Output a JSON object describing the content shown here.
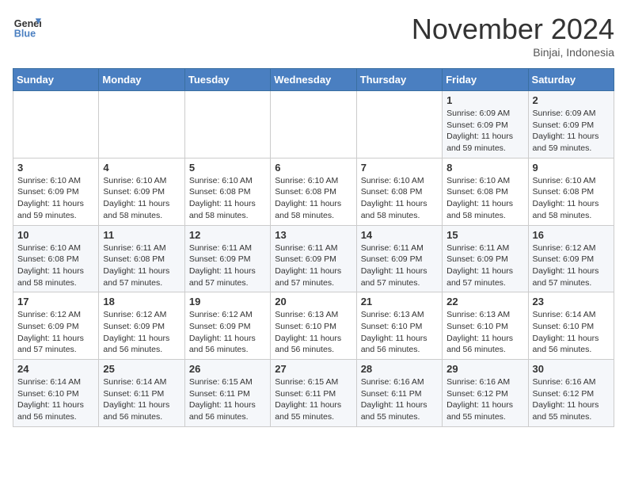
{
  "header": {
    "logo_line1": "General",
    "logo_line2": "Blue",
    "month_title": "November 2024",
    "location": "Binjai, Indonesia"
  },
  "weekdays": [
    "Sunday",
    "Monday",
    "Tuesday",
    "Wednesday",
    "Thursday",
    "Friday",
    "Saturday"
  ],
  "weeks": [
    [
      {
        "day": "",
        "info": ""
      },
      {
        "day": "",
        "info": ""
      },
      {
        "day": "",
        "info": ""
      },
      {
        "day": "",
        "info": ""
      },
      {
        "day": "",
        "info": ""
      },
      {
        "day": "1",
        "info": "Sunrise: 6:09 AM\nSunset: 6:09 PM\nDaylight: 11 hours and 59 minutes."
      },
      {
        "day": "2",
        "info": "Sunrise: 6:09 AM\nSunset: 6:09 PM\nDaylight: 11 hours and 59 minutes."
      }
    ],
    [
      {
        "day": "3",
        "info": "Sunrise: 6:10 AM\nSunset: 6:09 PM\nDaylight: 11 hours and 59 minutes."
      },
      {
        "day": "4",
        "info": "Sunrise: 6:10 AM\nSunset: 6:09 PM\nDaylight: 11 hours and 58 minutes."
      },
      {
        "day": "5",
        "info": "Sunrise: 6:10 AM\nSunset: 6:08 PM\nDaylight: 11 hours and 58 minutes."
      },
      {
        "day": "6",
        "info": "Sunrise: 6:10 AM\nSunset: 6:08 PM\nDaylight: 11 hours and 58 minutes."
      },
      {
        "day": "7",
        "info": "Sunrise: 6:10 AM\nSunset: 6:08 PM\nDaylight: 11 hours and 58 minutes."
      },
      {
        "day": "8",
        "info": "Sunrise: 6:10 AM\nSunset: 6:08 PM\nDaylight: 11 hours and 58 minutes."
      },
      {
        "day": "9",
        "info": "Sunrise: 6:10 AM\nSunset: 6:08 PM\nDaylight: 11 hours and 58 minutes."
      }
    ],
    [
      {
        "day": "10",
        "info": "Sunrise: 6:10 AM\nSunset: 6:08 PM\nDaylight: 11 hours and 58 minutes."
      },
      {
        "day": "11",
        "info": "Sunrise: 6:11 AM\nSunset: 6:08 PM\nDaylight: 11 hours and 57 minutes."
      },
      {
        "day": "12",
        "info": "Sunrise: 6:11 AM\nSunset: 6:09 PM\nDaylight: 11 hours and 57 minutes."
      },
      {
        "day": "13",
        "info": "Sunrise: 6:11 AM\nSunset: 6:09 PM\nDaylight: 11 hours and 57 minutes."
      },
      {
        "day": "14",
        "info": "Sunrise: 6:11 AM\nSunset: 6:09 PM\nDaylight: 11 hours and 57 minutes."
      },
      {
        "day": "15",
        "info": "Sunrise: 6:11 AM\nSunset: 6:09 PM\nDaylight: 11 hours and 57 minutes."
      },
      {
        "day": "16",
        "info": "Sunrise: 6:12 AM\nSunset: 6:09 PM\nDaylight: 11 hours and 57 minutes."
      }
    ],
    [
      {
        "day": "17",
        "info": "Sunrise: 6:12 AM\nSunset: 6:09 PM\nDaylight: 11 hours and 57 minutes."
      },
      {
        "day": "18",
        "info": "Sunrise: 6:12 AM\nSunset: 6:09 PM\nDaylight: 11 hours and 56 minutes."
      },
      {
        "day": "19",
        "info": "Sunrise: 6:12 AM\nSunset: 6:09 PM\nDaylight: 11 hours and 56 minutes."
      },
      {
        "day": "20",
        "info": "Sunrise: 6:13 AM\nSunset: 6:10 PM\nDaylight: 11 hours and 56 minutes."
      },
      {
        "day": "21",
        "info": "Sunrise: 6:13 AM\nSunset: 6:10 PM\nDaylight: 11 hours and 56 minutes."
      },
      {
        "day": "22",
        "info": "Sunrise: 6:13 AM\nSunset: 6:10 PM\nDaylight: 11 hours and 56 minutes."
      },
      {
        "day": "23",
        "info": "Sunrise: 6:14 AM\nSunset: 6:10 PM\nDaylight: 11 hours and 56 minutes."
      }
    ],
    [
      {
        "day": "24",
        "info": "Sunrise: 6:14 AM\nSunset: 6:10 PM\nDaylight: 11 hours and 56 minutes."
      },
      {
        "day": "25",
        "info": "Sunrise: 6:14 AM\nSunset: 6:11 PM\nDaylight: 11 hours and 56 minutes."
      },
      {
        "day": "26",
        "info": "Sunrise: 6:15 AM\nSunset: 6:11 PM\nDaylight: 11 hours and 56 minutes."
      },
      {
        "day": "27",
        "info": "Sunrise: 6:15 AM\nSunset: 6:11 PM\nDaylight: 11 hours and 55 minutes."
      },
      {
        "day": "28",
        "info": "Sunrise: 6:16 AM\nSunset: 6:11 PM\nDaylight: 11 hours and 55 minutes."
      },
      {
        "day": "29",
        "info": "Sunrise: 6:16 AM\nSunset: 6:12 PM\nDaylight: 11 hours and 55 minutes."
      },
      {
        "day": "30",
        "info": "Sunrise: 6:16 AM\nSunset: 6:12 PM\nDaylight: 11 hours and 55 minutes."
      }
    ]
  ]
}
